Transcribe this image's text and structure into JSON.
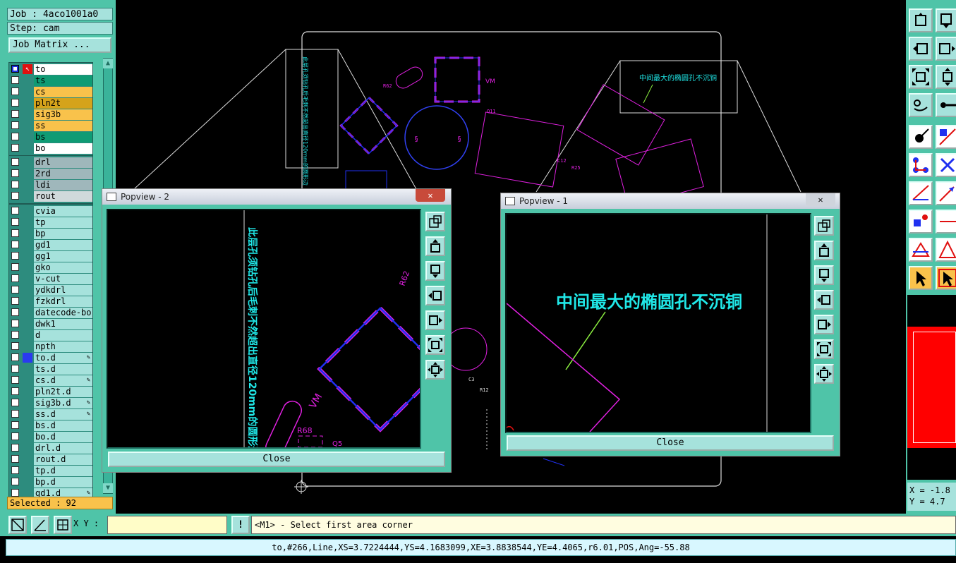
{
  "job_label": "Job : 4aco1001a0",
  "step_label": "Step: cam",
  "job_matrix_button": "Job Matrix ...",
  "layers_group1": [
    {
      "name": "to",
      "color": "#ffffff",
      "checked": true,
      "cursor": true
    },
    {
      "name": "ts",
      "color": "#0f9b74"
    },
    {
      "name": "cs",
      "color": "#f9c24b"
    },
    {
      "name": "pln2t",
      "color": "#d5a31b"
    },
    {
      "name": "sig3b",
      "color": "#f9c24b"
    },
    {
      "name": "ss",
      "color": "#f9c24b"
    },
    {
      "name": "bs",
      "color": "#0f9b74"
    },
    {
      "name": "bo",
      "color": "#ffffff"
    }
  ],
  "layers_group2": [
    {
      "name": "drl",
      "color": "#9fb7bb"
    },
    {
      "name": "2rd",
      "color": "#9fb7bb"
    },
    {
      "name": "ldi",
      "color": "#9fb7bb"
    },
    {
      "name": "rout",
      "color": "#cfd9db"
    }
  ],
  "layers_group3": [
    {
      "name": "cvia"
    },
    {
      "name": "tp"
    },
    {
      "name": "bp"
    },
    {
      "name": "gd1"
    },
    {
      "name": "gg1"
    },
    {
      "name": "gko"
    },
    {
      "name": "v-cut"
    },
    {
      "name": "ydkdrl"
    },
    {
      "name": "fzkdrl"
    },
    {
      "name": "datecode-bo"
    },
    {
      "name": "dwk1"
    },
    {
      "name": "d"
    },
    {
      "name": "npth"
    },
    {
      "name": "to.d",
      "selected": true,
      "tag": "✎"
    },
    {
      "name": "ts.d"
    },
    {
      "name": "cs.d",
      "tag": "✎"
    },
    {
      "name": "pln2t.d"
    },
    {
      "name": "sig3b.d",
      "tag": "✎"
    },
    {
      "name": "ss.d",
      "tag": "✎"
    },
    {
      "name": "bs.d"
    },
    {
      "name": "bo.d"
    },
    {
      "name": "drl.d"
    },
    {
      "name": "rout.d"
    },
    {
      "name": "tp.d"
    },
    {
      "name": "bp.d"
    },
    {
      "name": "gd1.d",
      "tag": "✎"
    }
  ],
  "selected_label": "Selected : 92",
  "popview2": {
    "title": "Popview - 2",
    "close_x": "✕",
    "vertical_text": "此层孔须钻孔后毛刺不然超出直径120mm的圆形边",
    "ref_r62": "R62",
    "ref_r68": "R68",
    "ref_q5": "Q5",
    "ref_vm": "VM",
    "close_button": "Close"
  },
  "popview1": {
    "title": "Popview - 1",
    "close_x": "✕",
    "note": "中间最大的椭圆孔不沉铜",
    "close_button": "Close"
  },
  "main_note": "中间最大的椭圆孔不沉铜",
  "coords": {
    "x": "X = -1.8",
    "y": "Y = 4.7"
  },
  "xy_label": "X Y :",
  "xy_input_value": "",
  "prompt_icon": "!",
  "prompt_text": "<M1> - Select first area corner",
  "status_text": "to,#266,Line,XS=3.7224444,YS=4.1683099,XE=3.8838544,YE=4.4065,r6.01,POS,Ang=-55.88",
  "colors": {
    "panel": "#4fc4a8",
    "cell": "#a6e2dc",
    "magenta": "#e020e0",
    "blue": "#2030f0",
    "cyan": "#20e8e8"
  }
}
